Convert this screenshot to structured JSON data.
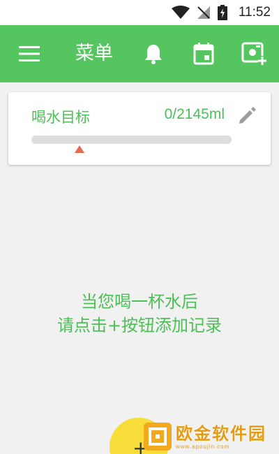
{
  "status_bar": {
    "time": "11:52",
    "icons": [
      "wifi-icon",
      "signal-off-icon",
      "battery-charging-icon"
    ]
  },
  "toolbar": {
    "title": "菜单",
    "icons": [
      "menu-icon",
      "bell-icon",
      "calendar-icon",
      "image-add-icon"
    ]
  },
  "goal_card": {
    "label": "喝水目标",
    "value": "0/2145ml",
    "progress_fraction": 0,
    "edit_icon": "pencil-icon"
  },
  "empty_hint": {
    "line1": "当您喝一杯水后",
    "line2": "请点击+按钮添加记录"
  },
  "fab": {
    "icon": "plus-icon",
    "label": "+"
  },
  "watermark": {
    "title": "欧金软件园",
    "url": "www.apoujin.com"
  },
  "colors": {
    "primary": "#55c65f",
    "text_green": "#4cbf56",
    "fab": "#f6dd3a",
    "marker": "#e46b4e",
    "watermark": "#e79b12"
  }
}
